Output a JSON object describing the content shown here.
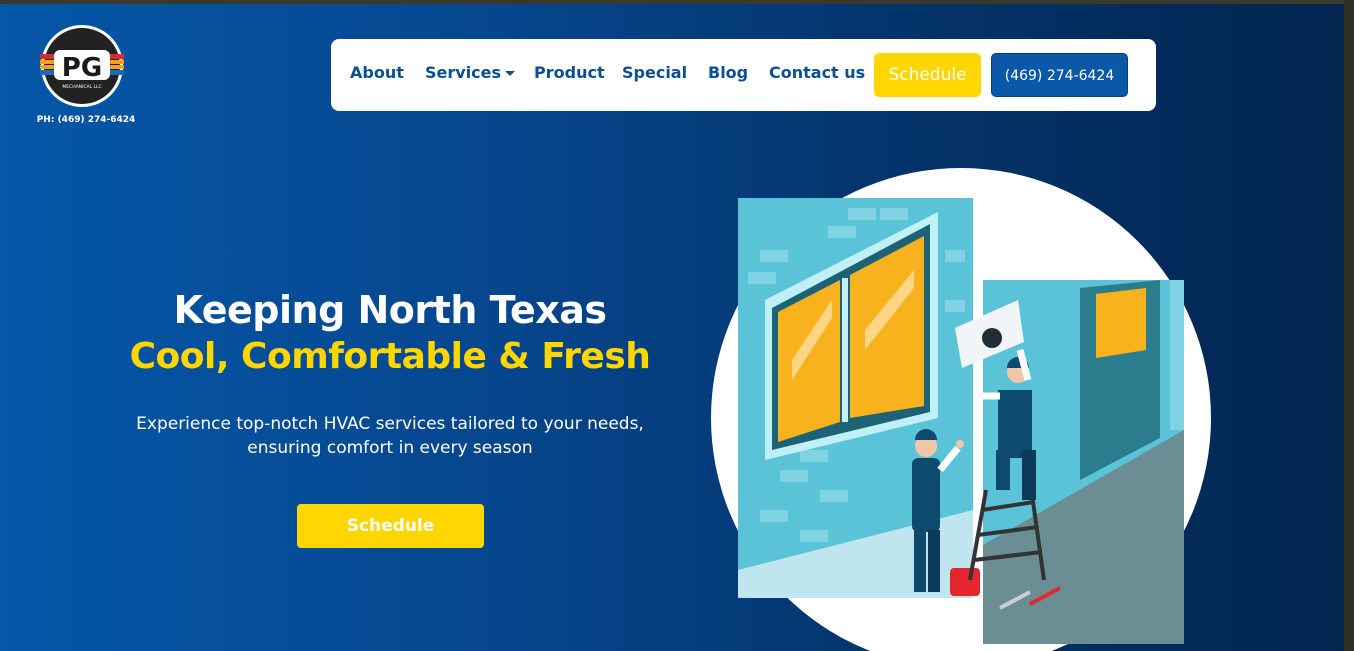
{
  "logo": {
    "mark": "PG",
    "sub": "MECHANICAL LLC",
    "phone": "PH: (469) 274-6424"
  },
  "nav": {
    "items": [
      {
        "label": "About"
      },
      {
        "label": "Services"
      },
      {
        "label": "Product"
      },
      {
        "label": "Special"
      },
      {
        "label": "Blog"
      },
      {
        "label": "Contact us"
      }
    ],
    "schedule_label": "Schedule",
    "phone_label": "(469) 274-6424"
  },
  "hero": {
    "headline": "Keeping North Texas",
    "subheadline": "Cool, Comfortable & Fresh",
    "description_line1": "Experience top-notch HVAC services tailored to your needs,",
    "description_line2": "ensuring comfort in every season",
    "cta_label": "Schedule"
  },
  "colors": {
    "brand_blue": "#0b4f91",
    "accent_yellow": "#ffd600",
    "background_start": "#0557a8",
    "background_end": "#02254f",
    "illustration_wall": "#5bc3d8"
  },
  "illustration": {
    "icon": "hvac-technicians-illustration"
  }
}
